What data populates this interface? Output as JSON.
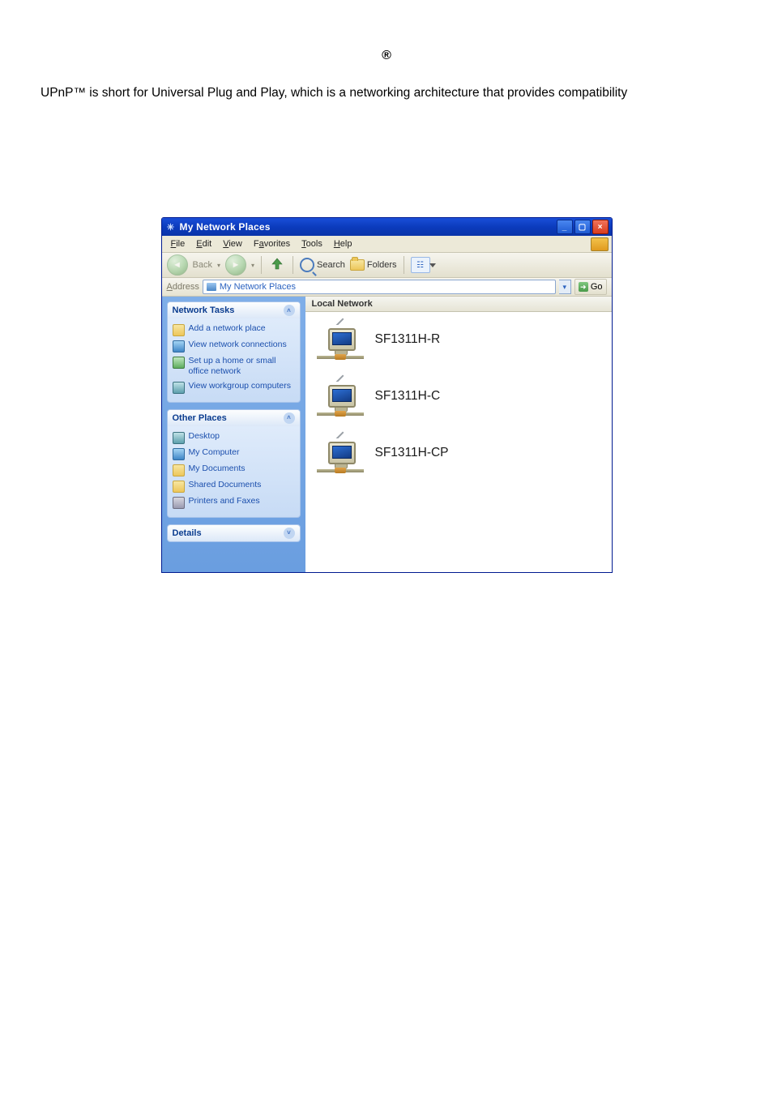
{
  "header": {
    "registered_symbol": "®"
  },
  "intro": "UPnP™ is short for Universal Plug and Play, which is a networking architecture that provides compatibility",
  "window": {
    "title": "My Network Places",
    "menus": {
      "file": "File",
      "edit": "Edit",
      "view": "View",
      "favorites": "Favorites",
      "tools": "Tools",
      "help": "Help"
    },
    "toolbar": {
      "back": "Back",
      "search": "Search",
      "folders": "Folders"
    },
    "address": {
      "label": "Address",
      "value": "My Network Places",
      "go": "Go"
    },
    "sidebar": {
      "network_tasks": {
        "title": "Network Tasks",
        "items": [
          "Add a network place",
          "View network connections",
          "Set up a home or small office network",
          "View workgroup computers"
        ]
      },
      "other_places": {
        "title": "Other Places",
        "items": [
          "Desktop",
          "My Computer",
          "My Documents",
          "Shared Documents",
          "Printers and Faxes"
        ]
      },
      "details": {
        "title": "Details"
      }
    },
    "content": {
      "section": "Local Network",
      "items": [
        "SF1311H-R",
        "SF1311H-C",
        "SF1311H-CP"
      ]
    }
  }
}
